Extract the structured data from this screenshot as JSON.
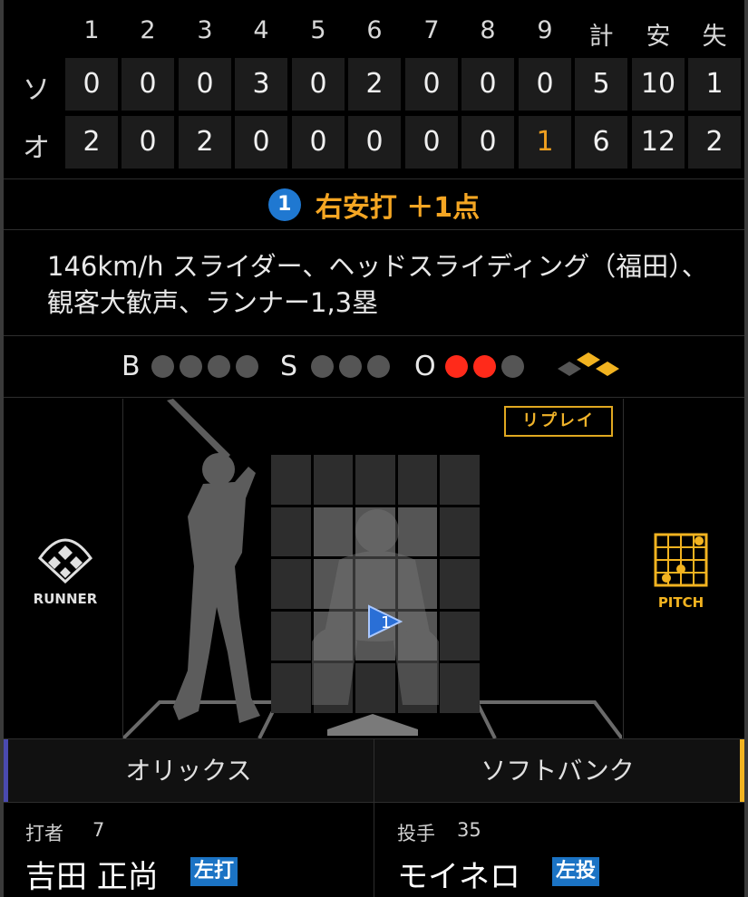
{
  "scoreboard": {
    "innings": [
      "1",
      "2",
      "3",
      "4",
      "5",
      "6",
      "7",
      "8",
      "9"
    ],
    "total_labels": {
      "runs": "計",
      "hits": "安",
      "errors": "失"
    },
    "teams": [
      {
        "label": "ソ",
        "innings": [
          "0",
          "0",
          "0",
          "3",
          "0",
          "2",
          "0",
          "0",
          "0"
        ],
        "runs": "5",
        "hits": "10",
        "errors": "1"
      },
      {
        "label": "オ",
        "innings": [
          "2",
          "0",
          "2",
          "0",
          "0",
          "0",
          "0",
          "0",
          "1"
        ],
        "runs": "6",
        "hits": "12",
        "errors": "2"
      }
    ],
    "highlight_color": "#f0a020"
  },
  "play": {
    "number": "1",
    "result": "右安打 ＋1点",
    "description": "146km/h スライダー、ヘッドスライディング（福田）、観客大歓声、ランナー1,3塁"
  },
  "count": {
    "balls_label": "B",
    "strikes_label": "S",
    "outs_label": "O",
    "balls": 0,
    "strikes": 0,
    "outs": 2,
    "bases": {
      "first": true,
      "second": false,
      "third": true
    }
  },
  "field": {
    "replay_label": "リプレイ",
    "runner_label": "RUNNER",
    "pitch_label": "PITCH",
    "pitch_marker": "1",
    "accent": "#f2b320"
  },
  "teams": {
    "left": "オリックス",
    "right": "ソフトバンク",
    "left_color": "#4a4ab0",
    "right_color": "#f2b320"
  },
  "batter": {
    "role": "打者",
    "number": "7",
    "name": "吉田 正尚",
    "hand": "左打"
  },
  "pitcher": {
    "role": "投手",
    "number": "35",
    "name": "モイネロ",
    "hand": "左投"
  }
}
